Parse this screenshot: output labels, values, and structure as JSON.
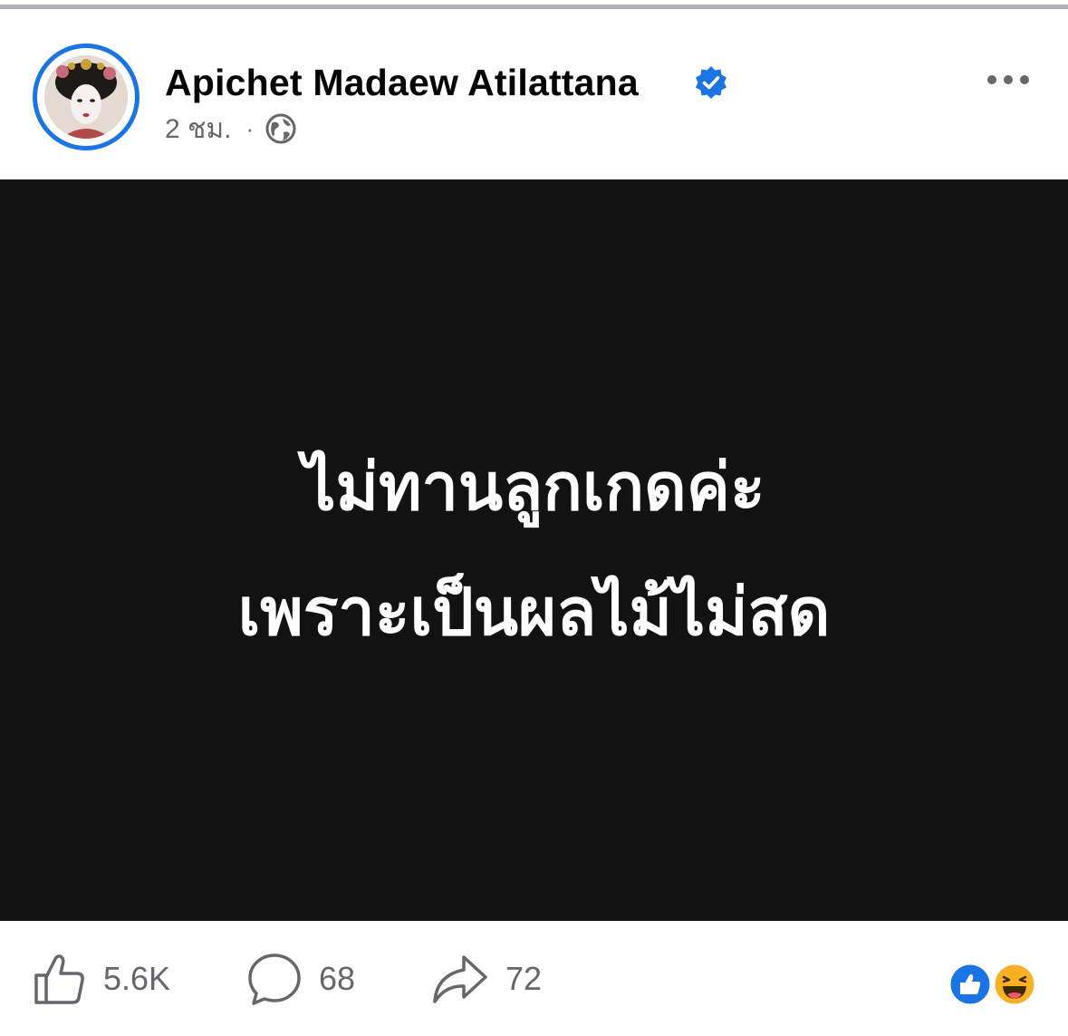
{
  "post": {
    "author_name": "Apichet Madaew Atilattana",
    "verified": true,
    "timestamp": "2 ชม.",
    "separator": "·",
    "privacy_icon": "globe-icon",
    "more_icon": "more-horizontal-icon",
    "image_text": {
      "line1": "ไม่ทานลูกเกดค่ะ",
      "line2": "เพราะเป็นผลไม้ไม่สด"
    }
  },
  "actions": {
    "like": {
      "icon": "like-icon",
      "count": "5.6K"
    },
    "comment": {
      "icon": "comment-icon",
      "count": "68"
    },
    "share": {
      "icon": "share-icon",
      "count": "72"
    }
  },
  "reactions": [
    "like-reaction",
    "haha-reaction"
  ],
  "colors": {
    "accent": "#1b74e4",
    "text_primary": "#050505",
    "text_secondary": "#65676b",
    "image_background": "#121212",
    "haha_yellow": "#f7b125"
  }
}
